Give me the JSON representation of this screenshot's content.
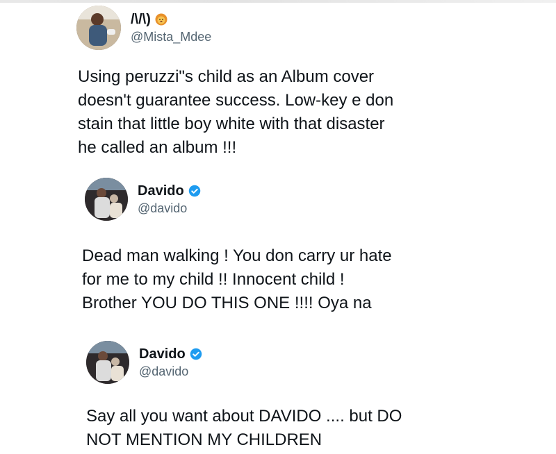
{
  "tweets": [
    {
      "display_name": "/\\/\\)",
      "handle": "@Mista_Mdee",
      "badge_icon": "lion-emoji-icon",
      "text": "Using peruzzi\"s child as an Album cover\ndoesn't guarantee success. Low-key e don\nstain that little boy white with that disaster\nhe called an album !!!"
    },
    {
      "display_name": "Davido",
      "handle": "@davido",
      "badge_icon": "verified-badge-icon",
      "text": "Dead man walking ! You don carry ur hate\nfor me to my child !! Innocent child !\nBrother  YOU DO THIS ONE !!!! Oya na"
    },
    {
      "display_name": "Davido",
      "handle": "@davido",
      "badge_icon": "verified-badge-icon",
      "text": "Say all you want about DAVIDO .... but DO\nNOT MENTION MY CHILDREN"
    }
  ],
  "colors": {
    "text": "#0f1419",
    "secondary": "#536471",
    "verified": "#1d9bf0"
  }
}
